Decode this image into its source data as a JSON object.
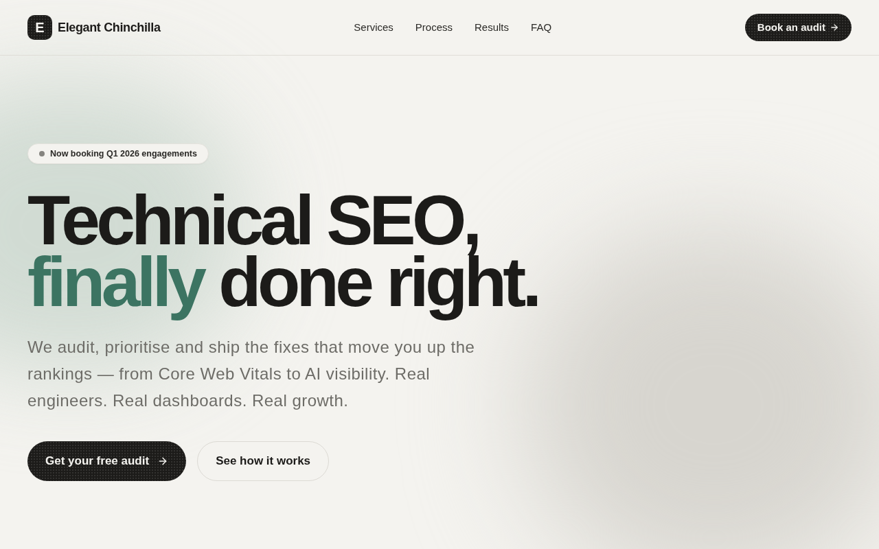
{
  "header": {
    "logo": {
      "letter": "E",
      "name": "Elegant Chinchilla"
    },
    "nav": [
      {
        "label": "Services"
      },
      {
        "label": "Process"
      },
      {
        "label": "Results"
      },
      {
        "label": "FAQ"
      }
    ],
    "cta": {
      "label": "Book an audit"
    }
  },
  "hero": {
    "badge": "Now booking Q1 2026 engagements",
    "headline": {
      "first_line": "Technical SEO,",
      "highlight": "finally",
      "rest": "done right."
    },
    "description": "We audit, prioritise and ship the fixes that move you up the rankings — from Core Web Vitals to AI visibility. Real engineers. Real dashboards. Real growth.",
    "buttons": [
      {
        "label": "Get your free audit",
        "kind": "primary"
      },
      {
        "label": "See how it works",
        "kind": "secondary"
      }
    ]
  }
}
